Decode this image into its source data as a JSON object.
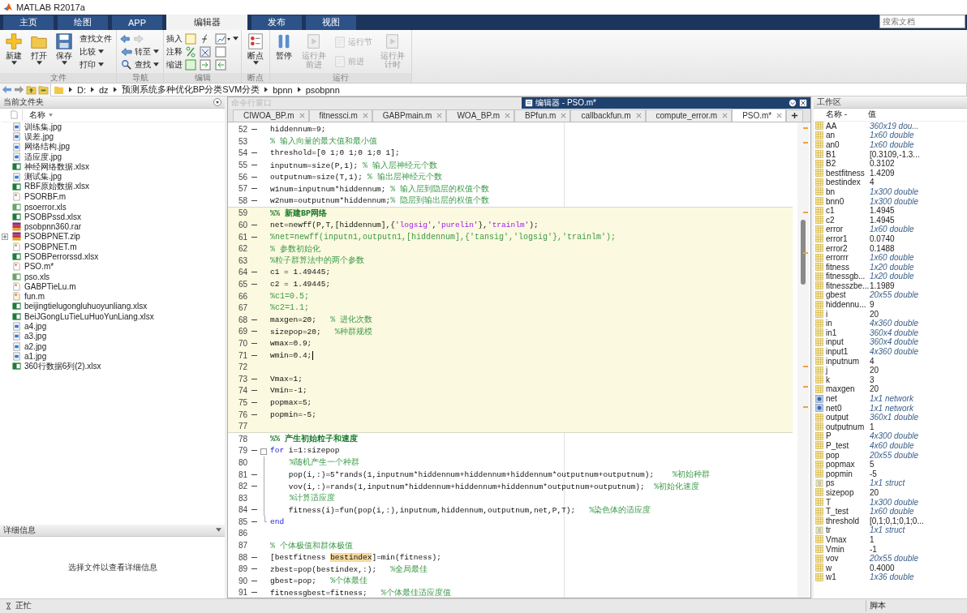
{
  "window": {
    "title": "MATLAB R2017a"
  },
  "ribbon_tabs": [
    {
      "label": "主页",
      "selected": false
    },
    {
      "label": "绘图",
      "selected": false
    },
    {
      "label": "APP",
      "selected": false
    },
    {
      "label": "编辑器",
      "selected": true
    },
    {
      "label": "发布",
      "selected": false
    },
    {
      "label": "视图",
      "selected": false
    }
  ],
  "search": {
    "placeholder": "搜索文档"
  },
  "toolstrip": {
    "groups": [
      {
        "label": "文件",
        "items": [
          {
            "kind": "large",
            "label": "新建",
            "dropdown": true,
            "disabled": false
          },
          {
            "kind": "large",
            "label": "打开",
            "dropdown": true,
            "disabled": false
          },
          {
            "kind": "large",
            "label": "保存",
            "dropdown": true,
            "disabled": false
          },
          {
            "kind": "stack",
            "rows": [
              {
                "kind": "icon-label",
                "label": "查找文件",
                "dropdown": false,
                "disabled": false
              },
              {
                "kind": "icon-label",
                "label": "比较",
                "dropdown": true,
                "disabled": false
              },
              {
                "kind": "icon-label",
                "label": "打印",
                "dropdown": true,
                "disabled": false
              }
            ]
          }
        ]
      },
      {
        "label": "导航",
        "items": [
          {
            "kind": "stack",
            "rows": [
              {
                "kind": "icons",
                "disabled": false
              },
              {
                "kind": "icon-label",
                "label": "转至",
                "dropdown": true,
                "disabled": false
              },
              {
                "kind": "icon-label",
                "label": "查找",
                "dropdown": true,
                "disabled": false
              }
            ]
          }
        ]
      },
      {
        "label": "编辑",
        "items": [
          {
            "kind": "stack",
            "rows": [
              {
                "kind": "label-icons",
                "label": "插入",
                "dropdown": true,
                "disabled": false
              },
              {
                "kind": "label-icons",
                "label": "注释",
                "dropdown": false,
                "disabled": false
              },
              {
                "kind": "label-icons",
                "label": "缩进",
                "dropdown": false,
                "disabled": false
              }
            ]
          }
        ]
      },
      {
        "label": "断点",
        "items": [
          {
            "kind": "large",
            "label": "断点",
            "dropdown": true,
            "disabled": false
          }
        ]
      },
      {
        "label": "运行",
        "items": [
          {
            "kind": "large",
            "label": "暂停",
            "dropdown": false,
            "disabled": false
          },
          {
            "kind": "large",
            "label": "运行并前进",
            "dropdown": false,
            "disabled": true
          },
          {
            "kind": "stack",
            "rows": [
              {
                "kind": "icon-label",
                "label": "运行节",
                "dropdown": false,
                "disabled": true
              },
              {
                "kind": "icon-label",
                "label": "前进",
                "dropdown": false,
                "disabled": true
              }
            ]
          },
          {
            "kind": "large",
            "label": "运行并计时",
            "dropdown": false,
            "disabled": true
          }
        ]
      }
    ]
  },
  "address": {
    "segments": [
      "D:",
      "dz",
      "预测系统多种优化BP分类SVM分类",
      "bpnn",
      "psobpnn"
    ]
  },
  "file_panel": {
    "title": "当前文件夹",
    "column": "名称",
    "files": [
      {
        "name": "训练集.jpg",
        "kind": "image",
        "expandable": false
      },
      {
        "name": "误差.jpg",
        "kind": "image",
        "expandable": false
      },
      {
        "name": "网络结构.jpg",
        "kind": "image",
        "expandable": false
      },
      {
        "name": "适应度.jpg",
        "kind": "image",
        "expandable": false
      },
      {
        "name": "神经网络数据.xlsx",
        "kind": "sheet",
        "expandable": false
      },
      {
        "name": "测试集.jpg",
        "kind": "image",
        "expandable": false
      },
      {
        "name": "RBF原始数据.xlsx",
        "kind": "sheet",
        "expandable": false
      },
      {
        "name": "PSORBF.m",
        "kind": "script",
        "expandable": false
      },
      {
        "name": "psoerror.xls",
        "kind": "oldsheet",
        "expandable": false
      },
      {
        "name": "PSOBPssd.xlsx",
        "kind": "sheet",
        "expandable": false
      },
      {
        "name": "psobpnn360.rar",
        "kind": "archive",
        "expandable": false
      },
      {
        "name": "PSOBPNET.zip",
        "kind": "archive",
        "expandable": true
      },
      {
        "name": "PSOBPNET.m",
        "kind": "script",
        "expandable": false
      },
      {
        "name": "PSOBPerrorssd.xlsx",
        "kind": "sheet",
        "expandable": false
      },
      {
        "name": "PSO.m*",
        "kind": "script",
        "expandable": false
      },
      {
        "name": "pso.xls",
        "kind": "oldsheet",
        "expandable": false
      },
      {
        "name": "GABPTieLu.m",
        "kind": "script",
        "expandable": false
      },
      {
        "name": "fun.m",
        "kind": "function",
        "expandable": false
      },
      {
        "name": "beijingtielugongluhuoyunliang.xlsx",
        "kind": "sheet",
        "expandable": false
      },
      {
        "name": "BeiJGongLuTieLuHuoYunLiang.xlsx",
        "kind": "sheet",
        "expandable": false
      },
      {
        "name": "a4.jpg",
        "kind": "image",
        "expandable": false
      },
      {
        "name": "a3.jpg",
        "kind": "image",
        "expandable": false
      },
      {
        "name": "a2.jpg",
        "kind": "image",
        "expandable": false
      },
      {
        "name": "a1.jpg",
        "kind": "image",
        "expandable": false
      },
      {
        "name": "360行数据6列(2).xlsx",
        "kind": "sheet",
        "expandable": false
      }
    ],
    "details": {
      "title": "详细信息",
      "message": "选择文件以查看详细信息"
    }
  },
  "editor": {
    "command_window_title": "命令行窗口",
    "title": "编辑器 - PSO.m*",
    "tabs": [
      {
        "label": "CIWOA_BP.m",
        "selected": false
      },
      {
        "label": "fitnessci.m",
        "selected": false
      },
      {
        "label": "GABPmain.m",
        "selected": false
      },
      {
        "label": "WOA_BP.m",
        "selected": false
      },
      {
        "label": "BPfun.m",
        "selected": false
      },
      {
        "label": "callbackfun.m",
        "selected": false
      },
      {
        "label": "compute_error.m",
        "selected": false
      },
      {
        "label": "PSO.m*",
        "selected": true
      }
    ],
    "lines": [
      {
        "number": "52",
        "dash": true,
        "highlighted": false,
        "cursor": false,
        "in_fold": false,
        "segments": [
          {
            "kind": "code",
            "text": "hiddennum=9;"
          }
        ]
      },
      {
        "number": "53",
        "dash": false,
        "highlighted": false,
        "cursor": false,
        "in_fold": false,
        "segments": [
          {
            "kind": "comment",
            "text": "% 输入向量的最大值和最小值"
          }
        ]
      },
      {
        "number": "54",
        "dash": true,
        "highlighted": false,
        "cursor": false,
        "in_fold": false,
        "segments": [
          {
            "kind": "code",
            "text": "threshold=[0 1;0 1;0 1;0 1];"
          }
        ]
      },
      {
        "number": "55",
        "dash": true,
        "highlighted": false,
        "cursor": false,
        "in_fold": false,
        "segments": [
          {
            "kind": "code",
            "text": "inputnum=size(P,1); "
          },
          {
            "kind": "comment",
            "text": "% 输入层神经元个数"
          }
        ]
      },
      {
        "number": "56",
        "dash": true,
        "highlighted": false,
        "cursor": false,
        "in_fold": false,
        "segments": [
          {
            "kind": "code",
            "text": "outputnum=size(T,1); "
          },
          {
            "kind": "comment",
            "text": "% 输出层神经元个数"
          }
        ]
      },
      {
        "number": "57",
        "dash": true,
        "highlighted": false,
        "cursor": false,
        "in_fold": false,
        "segments": [
          {
            "kind": "code",
            "text": "w1num=inputnum*hiddennum; "
          },
          {
            "kind": "comment",
            "text": "% 输入层到隐层的权值个数"
          }
        ]
      },
      {
        "number": "58",
        "dash": true,
        "highlighted": false,
        "cursor": false,
        "in_fold": false,
        "segments": [
          {
            "kind": "code",
            "text": "w2num=outputnum*hiddennum;"
          },
          {
            "kind": "comment",
            "text": "% 隐层到输出层的权值个数"
          }
        ]
      },
      {
        "number": "59",
        "dash": false,
        "highlighted": true,
        "cursor": false,
        "in_fold": false,
        "segments": [
          {
            "kind": "cell",
            "text": "%% 新建BP网络"
          }
        ]
      },
      {
        "number": "60",
        "dash": true,
        "highlighted": true,
        "cursor": false,
        "in_fold": false,
        "segments": [
          {
            "kind": "code",
            "text": "net=newff(P,T,[hiddennum],{"
          },
          {
            "kind": "string",
            "text": "'logsig'"
          },
          {
            "kind": "code",
            "text": ","
          },
          {
            "kind": "string",
            "text": "'purelin'"
          },
          {
            "kind": "code",
            "text": "},"
          },
          {
            "kind": "string",
            "text": "'trainlm'"
          },
          {
            "kind": "code",
            "text": ");"
          }
        ]
      },
      {
        "number": "61",
        "dash": true,
        "highlighted": true,
        "cursor": false,
        "in_fold": false,
        "segments": [
          {
            "kind": "comment",
            "text": "%net=newff(inputn1,outputn1,[hiddennum],{'tansig','logsig'},'trainlm');"
          }
        ]
      },
      {
        "number": "62",
        "dash": false,
        "highlighted": true,
        "cursor": false,
        "in_fold": false,
        "segments": [
          {
            "kind": "comment",
            "text": "% 参数初始化"
          }
        ]
      },
      {
        "number": "63",
        "dash": false,
        "highlighted": true,
        "cursor": false,
        "in_fold": false,
        "segments": [
          {
            "kind": "comment",
            "text": "%粒子群算法中的两个参数"
          }
        ]
      },
      {
        "number": "64",
        "dash": true,
        "highlighted": true,
        "cursor": false,
        "in_fold": false,
        "segments": [
          {
            "kind": "code",
            "text": "c1 = 1.49445;"
          }
        ]
      },
      {
        "number": "65",
        "dash": true,
        "highlighted": true,
        "cursor": false,
        "in_fold": false,
        "segments": [
          {
            "kind": "code",
            "text": "c2 = 1.49445;"
          }
        ]
      },
      {
        "number": "66",
        "dash": false,
        "highlighted": true,
        "cursor": false,
        "in_fold": false,
        "segments": [
          {
            "kind": "comment",
            "text": "%c1=0.5;"
          }
        ]
      },
      {
        "number": "67",
        "dash": false,
        "highlighted": true,
        "cursor": false,
        "in_fold": false,
        "segments": [
          {
            "kind": "comment",
            "text": "%c2=1.1;"
          }
        ]
      },
      {
        "number": "68",
        "dash": true,
        "highlighted": true,
        "cursor": false,
        "in_fold": false,
        "segments": [
          {
            "kind": "code",
            "text": "maxgen=20;   "
          },
          {
            "kind": "comment",
            "text": "% 进化次数"
          }
        ]
      },
      {
        "number": "69",
        "dash": true,
        "highlighted": true,
        "cursor": false,
        "in_fold": false,
        "segments": [
          {
            "kind": "code",
            "text": "sizepop=20;   "
          },
          {
            "kind": "comment",
            "text": "%种群规模"
          }
        ]
      },
      {
        "number": "70",
        "dash": true,
        "highlighted": true,
        "cursor": false,
        "in_fold": false,
        "segments": [
          {
            "kind": "code",
            "text": "wmax=0.9;"
          }
        ]
      },
      {
        "number": "71",
        "dash": true,
        "highlighted": true,
        "cursor": true,
        "in_fold": false,
        "segments": [
          {
            "kind": "code",
            "text": "wmin=0.4;"
          }
        ]
      },
      {
        "number": "72",
        "dash": false,
        "highlighted": true,
        "cursor": false,
        "in_fold": false
      },
      {
        "number": "73",
        "dash": true,
        "highlighted": true,
        "cursor": false,
        "in_fold": false,
        "segments": [
          {
            "kind": "code",
            "text": "Vmax=1;"
          }
        ]
      },
      {
        "number": "74",
        "dash": true,
        "highlighted": true,
        "cursor": false,
        "in_fold": false,
        "segments": [
          {
            "kind": "code",
            "text": "Vmin=-1;"
          }
        ]
      },
      {
        "number": "75",
        "dash": true,
        "highlighted": true,
        "cursor": false,
        "in_fold": false,
        "segments": [
          {
            "kind": "code",
            "text": "popmax=5;"
          }
        ]
      },
      {
        "number": "76",
        "dash": true,
        "highlighted": true,
        "cursor": false,
        "in_fold": false,
        "segments": [
          {
            "kind": "code",
            "text": "popmin=-5;"
          }
        ]
      },
      {
        "number": "77",
        "dash": false,
        "highlighted": true,
        "cursor": false,
        "in_fold": false
      },
      {
        "number": "78",
        "dash": false,
        "highlighted": false,
        "cursor": false,
        "in_fold": false,
        "segments": [
          {
            "kind": "cell",
            "text": "%% 产生初始粒子和速度"
          }
        ]
      },
      {
        "number": "79",
        "dash": true,
        "highlighted": false,
        "cursor": false,
        "in_fold": true,
        "segments": [
          {
            "kind": "keyword",
            "text": "for"
          },
          {
            "kind": "code",
            "text": " i=1:sizepop"
          }
        ]
      },
      {
        "number": "80",
        "dash": false,
        "highlighted": false,
        "cursor": false,
        "in_fold": true,
        "segments": [
          {
            "kind": "comment",
            "text": "    %随机产生一个种群"
          }
        ]
      },
      {
        "number": "81",
        "dash": true,
        "highlighted": false,
        "cursor": false,
        "in_fold": true,
        "segments": [
          {
            "kind": "code",
            "text": "    pop(i,:)=5*rands(1,inputnum*hiddennum+hiddennum+hiddennum*outputnum+outputnum);    "
          },
          {
            "kind": "comment",
            "text": "%初始种群"
          }
        ]
      },
      {
        "number": "82",
        "dash": true,
        "highlighted": false,
        "cursor": false,
        "in_fold": true,
        "segments": [
          {
            "kind": "code",
            "text": "    vov(i,:)=rands(1,inputnum*hiddennum+hiddennum+hiddennum*outputnum+outputnum);  "
          },
          {
            "kind": "comment",
            "text": "%初始化速度"
          }
        ]
      },
      {
        "number": "83",
        "dash": false,
        "highlighted": false,
        "cursor": false,
        "in_fold": true,
        "segments": [
          {
            "kind": "comment",
            "text": "    %计算适应度"
          }
        ]
      },
      {
        "number": "84",
        "dash": true,
        "highlighted": false,
        "cursor": false,
        "in_fold": true,
        "segments": [
          {
            "kind": "code",
            "text": "    fitness(i)=fun(pop(i,:),inputnum,hiddennum,outputnum,net,P,T);   "
          },
          {
            "kind": "comment",
            "text": "%染色体的适应度"
          }
        ]
      },
      {
        "number": "85",
        "dash": true,
        "highlighted": false,
        "cursor": false,
        "in_fold": true,
        "segments": [
          {
            "kind": "keyword",
            "text": "end"
          }
        ]
      },
      {
        "number": "86",
        "dash": false,
        "highlighted": false,
        "cursor": false,
        "in_fold": false
      },
      {
        "number": "87",
        "dash": false,
        "highlighted": false,
        "cursor": false,
        "in_fold": false,
        "segments": [
          {
            "kind": "comment",
            "text": "% 个体极值和群体极值"
          }
        ]
      },
      {
        "number": "88",
        "dash": true,
        "highlighted": false,
        "cursor": false,
        "in_fold": false,
        "segments": [
          {
            "kind": "code",
            "text": "[bestfitness "
          },
          {
            "kind": "match",
            "text": "bestindex"
          },
          {
            "kind": "code",
            "text": "]=min(fitness);"
          }
        ]
      },
      {
        "number": "89",
        "dash": true,
        "highlighted": false,
        "cursor": false,
        "in_fold": false,
        "segments": [
          {
            "kind": "code",
            "text": "zbest=pop(bestindex,:);   "
          },
          {
            "kind": "comment",
            "text": "%全局最佳"
          }
        ]
      },
      {
        "number": "90",
        "dash": true,
        "highlighted": false,
        "cursor": false,
        "in_fold": false,
        "segments": [
          {
            "kind": "code",
            "text": "gbest=pop;   "
          },
          {
            "kind": "comment",
            "text": "%个体最佳"
          }
        ]
      },
      {
        "number": "91",
        "dash": true,
        "highlighted": false,
        "cursor": false,
        "in_fold": false,
        "segments": [
          {
            "kind": "code",
            "text": "fitnessgbest=fitness;   "
          },
          {
            "kind": "comment",
            "text": "%个体最佳适应度值"
          }
        ]
      }
    ]
  },
  "workspace": {
    "title": "工作区",
    "columns": [
      "名称 -",
      "值"
    ],
    "rows": [
      {
        "name": "AA",
        "value": "360x19 dou...",
        "kind": "matrix",
        "summary": true
      },
      {
        "name": "an",
        "value": "1x60 double",
        "kind": "matrix",
        "summary": true
      },
      {
        "name": "an0",
        "value": "1x60 double",
        "kind": "matrix",
        "summary": true
      },
      {
        "name": "B1",
        "value": "[0.3109,-1.3...",
        "kind": "matrix",
        "summary": false
      },
      {
        "name": "B2",
        "value": "0.3102",
        "kind": "matrix",
        "summary": false
      },
      {
        "name": "bestfitness",
        "value": "1.4209",
        "kind": "matrix",
        "summary": false
      },
      {
        "name": "bestindex",
        "value": "4",
        "kind": "matrix",
        "summary": false
      },
      {
        "name": "bn",
        "value": "1x300 double",
        "kind": "matrix",
        "summary": true
      },
      {
        "name": "bnn0",
        "value": "1x300 double",
        "kind": "matrix",
        "summary": true
      },
      {
        "name": "c1",
        "value": "1.4945",
        "kind": "matrix",
        "summary": false
      },
      {
        "name": "c2",
        "value": "1.4945",
        "kind": "matrix",
        "summary": false
      },
      {
        "name": "error",
        "value": "1x60 double",
        "kind": "matrix",
        "summary": true
      },
      {
        "name": "error1",
        "value": "0.0740",
        "kind": "matrix",
        "summary": false
      },
      {
        "name": "error2",
        "value": "0.1488",
        "kind": "matrix",
        "summary": false
      },
      {
        "name": "errorrr",
        "value": "1x60 double",
        "kind": "matrix",
        "summary": true
      },
      {
        "name": "fitness",
        "value": "1x20 double",
        "kind": "matrix",
        "summary": true
      },
      {
        "name": "fitnessgb...",
        "value": "1x20 double",
        "kind": "matrix",
        "summary": true
      },
      {
        "name": "fitnesszbe...",
        "value": "1.1989",
        "kind": "matrix",
        "summary": false
      },
      {
        "name": "gbest",
        "value": "20x55 double",
        "kind": "matrix",
        "summary": true
      },
      {
        "name": "hiddennu...",
        "value": "9",
        "kind": "matrix",
        "summary": false
      },
      {
        "name": "i",
        "value": "20",
        "kind": "matrix",
        "summary": false
      },
      {
        "name": "in",
        "value": "4x360 double",
        "kind": "matrix",
        "summary": true
      },
      {
        "name": "in1",
        "value": "360x4 double",
        "kind": "matrix",
        "summary": true
      },
      {
        "name": "input",
        "value": "360x4 double",
        "kind": "matrix",
        "summary": true
      },
      {
        "name": "input1",
        "value": "4x360 double",
        "kind": "matrix",
        "summary": true
      },
      {
        "name": "inputnum",
        "value": "4",
        "kind": "matrix",
        "summary": false
      },
      {
        "name": "j",
        "value": "20",
        "kind": "matrix",
        "summary": false
      },
      {
        "name": "k",
        "value": "3",
        "kind": "matrix",
        "summary": false
      },
      {
        "name": "maxgen",
        "value": "20",
        "kind": "matrix",
        "summary": false
      },
      {
        "name": "net",
        "value": "1x1 network",
        "kind": "object",
        "summary": true
      },
      {
        "name": "net0",
        "value": "1x1 network",
        "kind": "object",
        "summary": true
      },
      {
        "name": "output",
        "value": "360x1 double",
        "kind": "matrix",
        "summary": true
      },
      {
        "name": "outputnum",
        "value": "1",
        "kind": "matrix",
        "summary": false
      },
      {
        "name": "P",
        "value": "4x300 double",
        "kind": "matrix",
        "summary": true
      },
      {
        "name": "P_test",
        "value": "4x60 double",
        "kind": "matrix",
        "summary": true
      },
      {
        "name": "pop",
        "value": "20x55 double",
        "kind": "matrix",
        "summary": true
      },
      {
        "name": "popmax",
        "value": "5",
        "kind": "matrix",
        "summary": false
      },
      {
        "name": "popmin",
        "value": "-5",
        "kind": "matrix",
        "summary": false
      },
      {
        "name": "ps",
        "value": "1x1 struct",
        "kind": "struct",
        "summary": true
      },
      {
        "name": "sizepop",
        "value": "20",
        "kind": "matrix",
        "summary": false
      },
      {
        "name": "T",
        "value": "1x300 double",
        "kind": "matrix",
        "summary": true
      },
      {
        "name": "T_test",
        "value": "1x60 double",
        "kind": "matrix",
        "summary": true
      },
      {
        "name": "threshold",
        "value": "[0,1;0,1;0,1;0...",
        "kind": "matrix",
        "summary": false
      },
      {
        "name": "tr",
        "value": "1x1 struct",
        "kind": "struct",
        "summary": true
      },
      {
        "name": "Vmax",
        "value": "1",
        "kind": "matrix",
        "summary": false
      },
      {
        "name": "Vmin",
        "value": "-1",
        "kind": "matrix",
        "summary": false
      },
      {
        "name": "vov",
        "value": "20x55 double",
        "kind": "matrix",
        "summary": true
      },
      {
        "name": "w",
        "value": "0.4000",
        "kind": "matrix",
        "summary": false
      },
      {
        "name": "w1",
        "value": "1x36 double",
        "kind": "matrix",
        "summary": true
      }
    ]
  },
  "status_bar": {
    "text": "正忙",
    "mode": "脚本"
  }
}
